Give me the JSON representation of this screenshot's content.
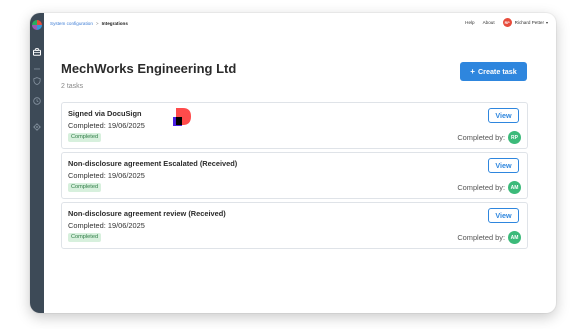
{
  "breadcrumb": {
    "parent": "System configuration",
    "separator": ">",
    "current": "Integrations"
  },
  "topbar": {
    "help": "Help",
    "about": "About",
    "user_initials": "RP",
    "user_name": "Richard Petter"
  },
  "page": {
    "title": "MechWorks Engineering Ltd",
    "task_count": "2 tasks"
  },
  "create_task": {
    "plus": "+",
    "label": "Create task"
  },
  "tasks": [
    {
      "title": "Signed via DocuSign",
      "date": "Completed: 19/06/2025",
      "status": "Completed",
      "view_label": "View",
      "completed_by_label": "Completed by:",
      "assignee_initials": "RP"
    },
    {
      "title": "Non-disclosure agreement Escalated (Received)",
      "date": "Completed: 19/06/2025",
      "status": "Completed",
      "view_label": "View",
      "completed_by_label": "Completed by:",
      "assignee_initials": "AM"
    },
    {
      "title": "Non-disclosure agreement review (Received)",
      "date": "Completed: 19/06/2025",
      "status": "Completed",
      "view_label": "View",
      "completed_by_label": "Completed by:",
      "assignee_initials": "AM"
    }
  ],
  "colors": {
    "sidebar": "#3d4a57",
    "accent": "#2e86de",
    "badge_bg": "#d7f0dd",
    "badge_text": "#2d7a43",
    "avatar_green": "#3cba7a",
    "avatar_red": "#e74c3c"
  },
  "icons": {
    "sidebar": [
      "app-logo-icon",
      "briefcase-icon",
      "dots-icon",
      "shield-icon",
      "clock-icon",
      "gear-icon"
    ],
    "card_logo": "docusign-logo-icon"
  }
}
